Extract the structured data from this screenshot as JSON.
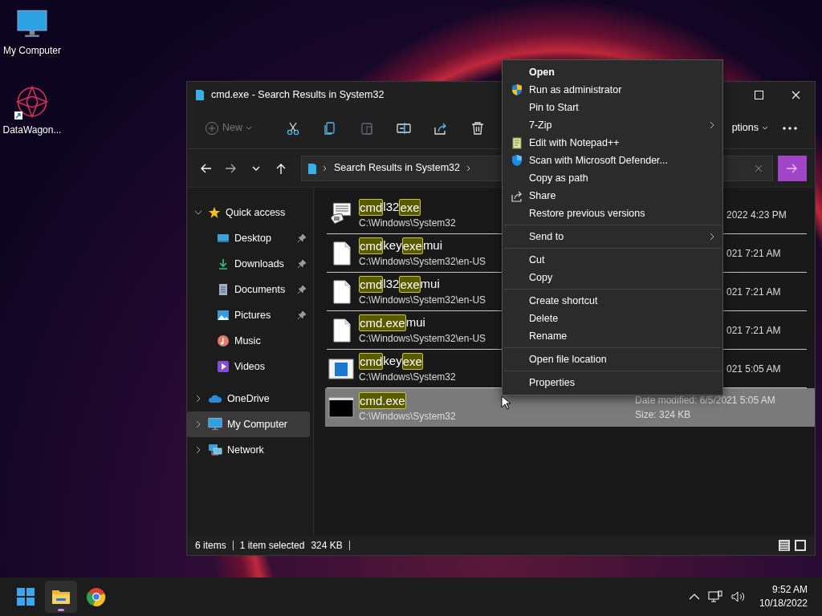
{
  "desktop_icons": [
    {
      "label": "My Computer",
      "kind": "computer",
      "shortcut": false
    },
    {
      "label": "DataWagon...",
      "kind": "app",
      "shortcut": true
    }
  ],
  "window": {
    "title": "cmd.exe - Search Results in System32"
  },
  "toolbar": {
    "buttons": [
      {
        "kind": "new",
        "label": "New",
        "disabled": true
      },
      {
        "kind": "cut",
        "disabled": false
      },
      {
        "kind": "copy",
        "disabled": false
      },
      {
        "kind": "paste",
        "disabled": true
      },
      {
        "kind": "rename",
        "disabled": false
      },
      {
        "kind": "share",
        "disabled": false
      },
      {
        "kind": "delete",
        "disabled": false
      }
    ],
    "options_label": "ptions"
  },
  "address": {
    "crumb": "Search Results in System32"
  },
  "nav": [
    {
      "label": "Quick access",
      "kind": "star",
      "expanded": true,
      "selected": false,
      "children": [
        {
          "label": "Desktop",
          "kind": "desktop",
          "pinned": true,
          "selected": false
        },
        {
          "label": "Downloads",
          "kind": "download",
          "pinned": true,
          "selected": false
        },
        {
          "label": "Documents",
          "kind": "document",
          "pinned": true,
          "selected": false
        },
        {
          "label": "Pictures",
          "kind": "picture",
          "pinned": true,
          "selected": false
        },
        {
          "label": "Music",
          "kind": "music",
          "pinned": false,
          "selected": false
        },
        {
          "label": "Videos",
          "kind": "video",
          "pinned": false,
          "selected": false
        }
      ]
    },
    {
      "label": "OneDrive",
      "kind": "cloud",
      "expanded": false,
      "selected": false
    },
    {
      "label": "My Computer",
      "kind": "computer",
      "expanded": false,
      "selected": true
    },
    {
      "label": "Network",
      "kind": "network",
      "expanded": false,
      "selected": false
    }
  ],
  "files": [
    {
      "kind": "phone",
      "name": [
        {
          "text": "cmd",
          "match": true
        },
        {
          "text": "l32",
          "match": false
        },
        {
          "text": "exe",
          "match": true
        }
      ],
      "path": "C:\\Windows\\System32",
      "details": [
        "2022 4:23 PM"
      ],
      "selected": false
    },
    {
      "kind": "blank",
      "name": [
        {
          "text": "cmd",
          "match": true
        },
        {
          "text": "key",
          "match": false
        },
        {
          "text": "exe",
          "match": true
        },
        {
          "text": "mui",
          "match": false
        }
      ],
      "path": "C:\\Windows\\System32\\en-US",
      "details": [
        "021 7:21 AM"
      ],
      "selected": false
    },
    {
      "kind": "blank",
      "name": [
        {
          "text": "cmd",
          "match": true
        },
        {
          "text": "l32",
          "match": false
        },
        {
          "text": "exe",
          "match": true
        },
        {
          "text": "mui",
          "match": false
        }
      ],
      "path": "C:\\Windows\\System32\\en-US",
      "details": [
        "021 7:21 AM"
      ],
      "selected": false
    },
    {
      "kind": "blank",
      "name": [
        {
          "text": "cmd.exe",
          "match": true
        },
        {
          "text": "mui",
          "match": false
        }
      ],
      "path": "C:\\Windows\\System32\\en-US",
      "details": [
        "021 7:21 AM"
      ],
      "selected": false
    },
    {
      "kind": "window",
      "name": [
        {
          "text": "cmd",
          "match": true
        },
        {
          "text": "key",
          "match": false
        },
        {
          "text": "exe",
          "match": true
        }
      ],
      "path": "C:\\Windows\\System32",
      "details": [
        "021 5:05 AM"
      ],
      "selected": false
    },
    {
      "kind": "console",
      "name": [
        {
          "text": "cmd.exe",
          "match": true
        }
      ],
      "path": "C:\\Windows\\System32",
      "details": [
        "Date modified: 6/5/2021 5:05 AM",
        "Size: 324 KB"
      ],
      "selected": true
    }
  ],
  "context_menu": {
    "groups": [
      [
        {
          "label": "Open",
          "default": true,
          "submenu": false
        },
        {
          "label": "Run as administrator",
          "kind": "shield",
          "default": false,
          "submenu": false
        },
        {
          "label": "Pin to Start",
          "default": false,
          "submenu": false
        },
        {
          "label": "7-Zip",
          "default": false,
          "submenu": true
        },
        {
          "label": "Edit with Notepad++",
          "kind": "notepad",
          "default": false,
          "submenu": false
        },
        {
          "label": "Scan with Microsoft Defender...",
          "kind": "defender",
          "default": false,
          "submenu": false
        },
        {
          "label": "Copy as path",
          "default": false,
          "submenu": false
        },
        {
          "label": "Share",
          "kind": "share",
          "default": false,
          "submenu": false
        },
        {
          "label": "Restore previous versions",
          "default": false,
          "submenu": false
        }
      ],
      [
        {
          "label": "Send to",
          "default": false,
          "submenu": true
        }
      ],
      [
        {
          "label": "Cut",
          "default": false,
          "submenu": false
        },
        {
          "label": "Copy",
          "default": false,
          "submenu": false
        }
      ],
      [
        {
          "label": "Create shortcut",
          "default": false,
          "submenu": false
        },
        {
          "label": "Delete",
          "default": false,
          "submenu": false
        },
        {
          "label": "Rename",
          "default": false,
          "submenu": false
        }
      ],
      [
        {
          "label": "Open file location",
          "default": false,
          "submenu": false
        }
      ],
      [
        {
          "label": "Properties",
          "default": false,
          "submenu": false
        }
      ]
    ]
  },
  "status_bar": {
    "count": "6 items",
    "selection": "1 item selected",
    "size": "324 KB"
  },
  "taskbar": {
    "apps": [
      {
        "kind": "start",
        "active": false
      },
      {
        "kind": "explorer",
        "active": true
      },
      {
        "kind": "browser",
        "active": false
      }
    ],
    "time": "9:52 AM",
    "date": "10/18/2022"
  }
}
